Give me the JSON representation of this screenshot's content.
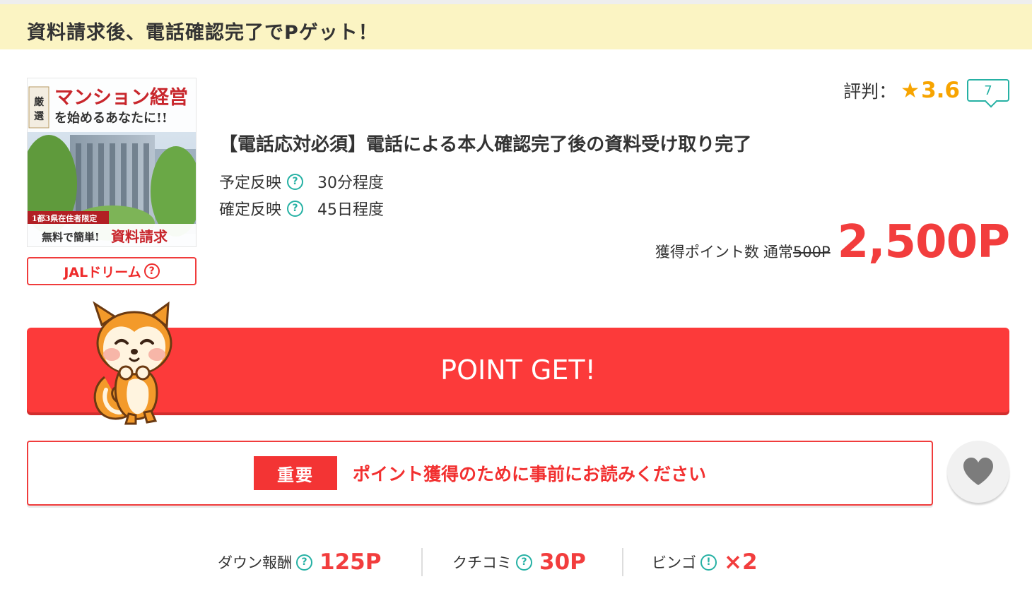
{
  "banner": {
    "text": "資料請求後、電話確認完了でPゲット！"
  },
  "thumbnail": {
    "tag": "厳選",
    "headline": "マンション経営",
    "subline": "を始めるあなたに!!",
    "region_note": "1都3県在住者限定",
    "cta_prefix": "無料で簡単!",
    "cta_main": "資料請求"
  },
  "jal": {
    "label": "JALドリーム",
    "help": "?"
  },
  "rating": {
    "label": "評判：",
    "star": "★",
    "value": "3.6",
    "review_count": "7"
  },
  "offer": {
    "title": "【電話応対必須】電話による本人確認完了後の資料受け取り完了",
    "reflect_rows": [
      {
        "label": "予定反映",
        "help": "?",
        "value": "30分程度"
      },
      {
        "label": "確定反映",
        "help": "?",
        "value": "45日程度"
      }
    ]
  },
  "points": {
    "label": "獲得ポイント数",
    "normal_label": "通常",
    "normal_value": "500P",
    "main_value": "2,500P"
  },
  "get_button": {
    "label": "POINT GET!"
  },
  "important": {
    "badge": "重要",
    "text": "ポイント獲得のために事前にお読みください"
  },
  "bonus": [
    {
      "label": "ダウン報酬",
      "icon": "?",
      "value": "125P"
    },
    {
      "label": "クチコミ",
      "icon": "?",
      "value": "30P"
    },
    {
      "label": "ビンゴ",
      "icon": "!",
      "value": "×2"
    }
  ],
  "colors": {
    "banner_bg": "#fbf4c3",
    "accent_red": "#fc3a3a",
    "teal": "#26b1a4",
    "star_orange": "#f7a400"
  }
}
